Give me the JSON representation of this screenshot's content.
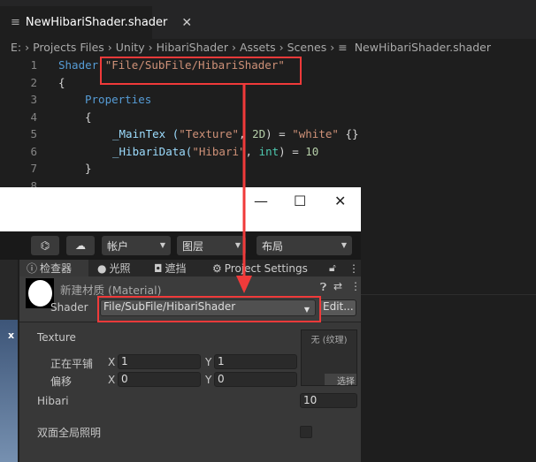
{
  "editor": {
    "tab_label": "NewHibariShader.shader",
    "breadcrumbs": [
      "E:",
      "Projects Files",
      "Unity",
      "HibariShader",
      "Assets",
      "Scenes",
      "NewHibariShader.shader"
    ],
    "lines": [
      {
        "n": "1",
        "a": "Shader ",
        "b": "\"File/SubFile/HibariShader\""
      },
      {
        "n": "2",
        "a": "{"
      },
      {
        "n": "3",
        "a": "Properties"
      },
      {
        "n": "4",
        "a": "{"
      },
      {
        "n": "5",
        "a": "_MainTex (",
        "b": "\"Texture\"",
        "c": ", ",
        "d": "2D",
        "e": ") = ",
        "f": "\"white\"",
        "g": " {}"
      },
      {
        "n": "6",
        "a": "_HibariData(",
        "b": "\"Hibari\"",
        "c": ", ",
        "d": "int",
        "e": ") = ",
        "f": "10"
      },
      {
        "n": "7",
        "a": "}"
      },
      {
        "n": "8",
        "a": ""
      }
    ]
  },
  "window": {
    "minimize": "—",
    "maximize": "☐",
    "close": "✕"
  },
  "toolbar": {
    "account": "帐户",
    "layers": "图层",
    "layout": "布局"
  },
  "tabs": {
    "inspector": "检查器",
    "lighting": "光照",
    "occlusion": "遮挡",
    "project_settings": "Project Settings"
  },
  "material": {
    "title": "新建材质 (Material)",
    "shader_label": "Shader",
    "shader_value": "File/SubFile/HibariShader",
    "edit": "Edit...",
    "texture_label": "Texture",
    "tiling_label": "正在平铺",
    "offset_label": "偏移",
    "x": "X",
    "y": "Y",
    "tiling_x": "1",
    "tiling_y": "1",
    "offset_x": "0",
    "offset_y": "0",
    "no_texture": "无 (纹理)",
    "select": "选择",
    "hibari_label": "Hibari",
    "hibari_value": "10",
    "double_sided_gi": "双面全局照明"
  },
  "left_panel": {
    "close": "x"
  },
  "colors": {
    "highlight": "#f03a3a"
  }
}
